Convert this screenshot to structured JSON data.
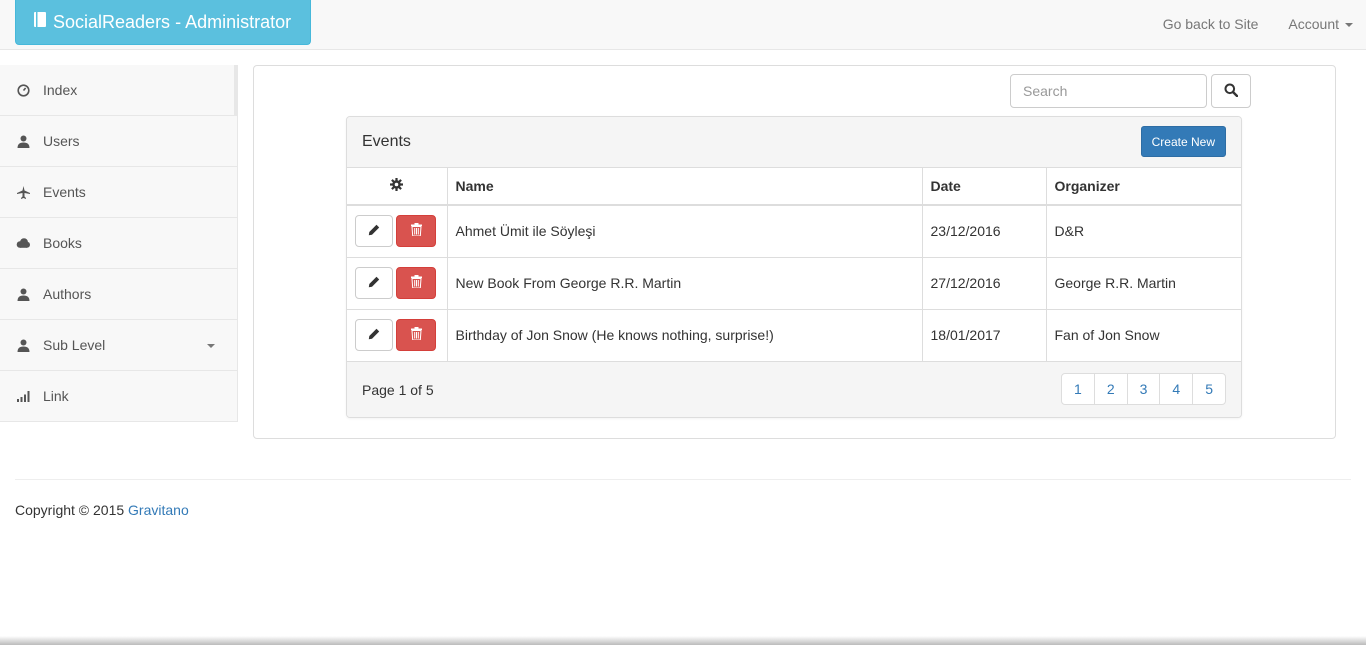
{
  "navbar": {
    "brand": "SocialReaders - Administrator",
    "brand_icon": "book-icon",
    "go_back": "Go back to Site",
    "account": "Account"
  },
  "sidebar": {
    "items": [
      {
        "label": "Index",
        "icon": "dashboard-icon"
      },
      {
        "label": "Users",
        "icon": "user-icon"
      },
      {
        "label": "Events",
        "icon": "plane-icon"
      },
      {
        "label": "Books",
        "icon": "cloud-icon"
      },
      {
        "label": "Authors",
        "icon": "user-icon"
      },
      {
        "label": "Sub Level",
        "icon": "user-icon"
      },
      {
        "label": "Link",
        "icon": "signal-icon"
      }
    ]
  },
  "search": {
    "placeholder": "Search",
    "icon": "search-icon"
  },
  "events_panel": {
    "title": "Events",
    "create_label": "Create New",
    "columns": {
      "actions_icon": "gear-icon",
      "name": "Name",
      "date": "Date",
      "organizer": "Organizer"
    },
    "rows": [
      {
        "name": "Ahmet Ümit ile Söyleşi",
        "date": "23/12/2016",
        "organizer": "D&R"
      },
      {
        "name": "New Book From George R.R. Martin",
        "date": "27/12/2016",
        "organizer": "George R.R. Martin"
      },
      {
        "name": "Birthday of Jon Snow (He knows nothing, surprise!)",
        "date": "18/01/2017",
        "organizer": "Fan of Jon Snow"
      }
    ],
    "page_info": "Page 1 of 5",
    "pages": [
      "1",
      "2",
      "3",
      "4",
      "5"
    ]
  },
  "footer": {
    "copyright": "Copyright © 2015",
    "link": "Gravitano"
  },
  "colors": {
    "brand": "#5bc0de",
    "primary": "#337ab7",
    "danger": "#d9534f"
  }
}
